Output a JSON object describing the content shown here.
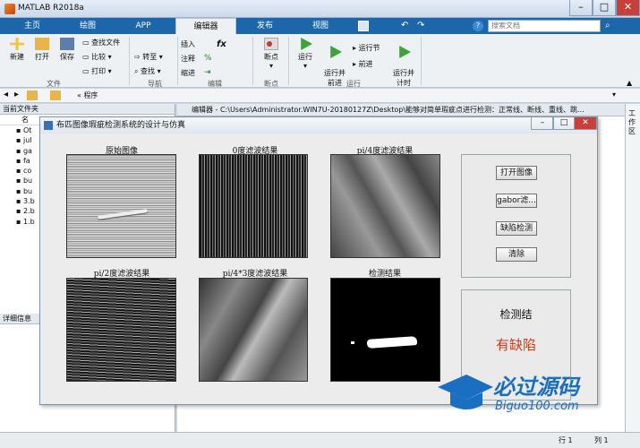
{
  "app": {
    "title": "MATLAB R2018a"
  },
  "tabs": [
    "主页",
    "绘图",
    "APP",
    "编辑器",
    "发布",
    "视图"
  ],
  "search": {
    "placeholder": "搜索文档"
  },
  "ribbon": {
    "file_group": {
      "name": "文件",
      "new": "新建",
      "open": "打开",
      "save": "保存",
      "find_files": "查找文件",
      "compare": "比较",
      "print": "打印"
    },
    "nav_group": {
      "name": "导航",
      "goto": "转至",
      "find": "查找"
    },
    "edit_group": {
      "name": "编辑",
      "insert": "插入",
      "comment": "注释",
      "indent": "缩进"
    },
    "breakpoint_group": {
      "name": "断点",
      "breakpoint": "断点"
    },
    "run_group": {
      "name": "运行",
      "run": "运行",
      "run_advance": "运行并\n前进",
      "run_section": "运行节",
      "advance": "前进",
      "run_time": "运行并\n计时"
    }
  },
  "address": {
    "path": "« 程序"
  },
  "left_pane": {
    "header": "当前文件夹",
    "name_col": "名",
    "files": [
      "Ot",
      "jul",
      "ga",
      "fa",
      "co",
      "bu",
      "bu",
      "3.b",
      "2.b",
      "1.b"
    ],
    "details": "详细信息"
  },
  "editor": {
    "title": "编辑器 - C:\\Users\\Administrator.WIN7U-20180127Z\\Desktop\\能够对简单瑕疵点进行检测：正常线、断线、重线、跳..."
  },
  "figure": {
    "title": "布匹图像瑕疵检测系统的设计与仿真",
    "captions": [
      "原始图像",
      "0度滤波结果",
      "pi/4度滤波结果",
      "pi/2度滤波结果",
      "pi/4*3度滤波结果",
      "检测结果"
    ],
    "buttons": {
      "open": "打开图像",
      "gabor": "gabor滤...",
      "detect": "缺陷检测",
      "clear": "清除"
    },
    "result_label": "检测结",
    "result_value": "有缺陷",
    "result_color": "#d23a1a"
  },
  "right_strip": {
    "label": "工作区"
  },
  "status": {
    "row_label": "行",
    "row": "1",
    "col_label": "列",
    "col": "1"
  },
  "watermark": {
    "cn": "必过源码",
    "en": "Biguo100.com"
  }
}
